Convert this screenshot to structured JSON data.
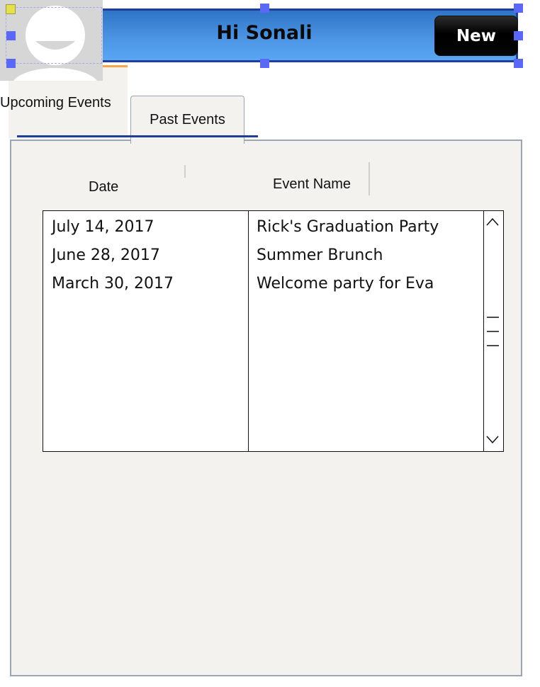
{
  "header": {
    "greeting": "Hi Sonali",
    "new_button": "New"
  },
  "tabs": [
    {
      "label": "Upcoming Events"
    },
    {
      "label": "Past Events"
    }
  ],
  "table": {
    "columns": [
      "Date",
      "Event Name"
    ],
    "rows": [
      {
        "date": "July 14, 2017",
        "event": "Rick's Graduation Party"
      },
      {
        "date": "June 28, 2017",
        "event": "Summer Brunch"
      },
      {
        "date": "March 30, 2017",
        "event": "Welcome party for Eva"
      }
    ]
  },
  "icons": {
    "avatar": "user-avatar-icon",
    "scroll_up": "chevron-up-icon",
    "scroll_down": "chevron-down-icon",
    "grip": "scroll-grip-icon"
  },
  "colors": {
    "header_top": "#2f74c6",
    "header_bottom": "#5aa6f4",
    "header_border": "#1f3f96",
    "tab_accent": "#f5a54a",
    "panel_bg": "#f3f2ee"
  }
}
